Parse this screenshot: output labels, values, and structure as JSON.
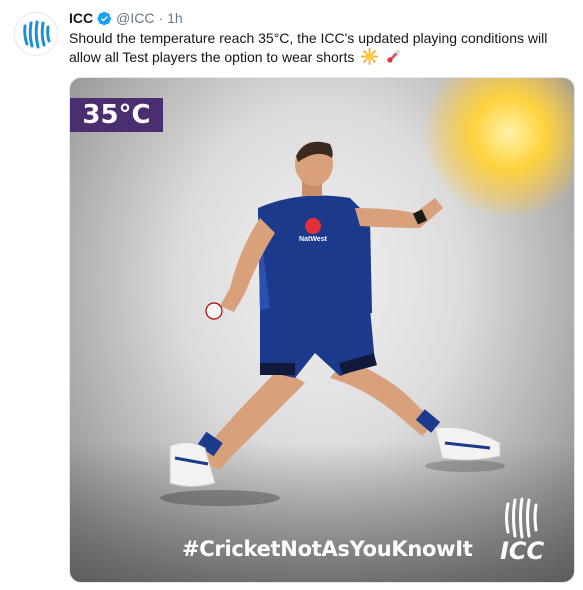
{
  "tweet": {
    "author_name": "ICC",
    "handle": "@ICC",
    "separator": "·",
    "time": "1h",
    "text": "Should the temperature reach 35°C, the ICC's updated playing conditions will allow all Test players the option to wear shorts",
    "emojis": [
      "sun-emoji",
      "thermometer-emoji"
    ]
  },
  "media": {
    "temperature_badge": "35°C",
    "hashtag": "#CricketNotAsYouKnowIt",
    "logo_text": "ICC",
    "shirt_sponsor": "NatWest",
    "badge_color": "#4b2e6f",
    "kit_color": "#1c3a8c"
  },
  "colors": {
    "verified": "#1da1f2",
    "text": "#14171a",
    "muted": "#657786"
  }
}
